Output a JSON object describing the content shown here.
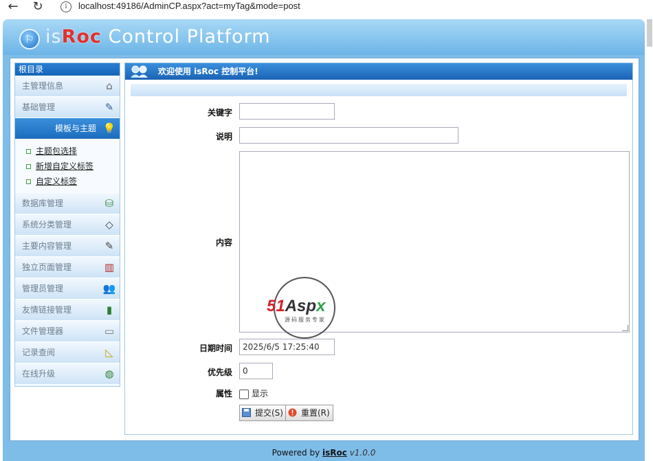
{
  "browser": {
    "back_icon": "←",
    "refresh_icon": "↻",
    "info_icon": "i",
    "url": "localhost:49186/AdminCP.aspx?act=myTag&mode=post"
  },
  "header": {
    "logo_mark": "⚐",
    "logo_is": "is",
    "logo_roc": "Roc",
    "logo_rest": " Control Platform"
  },
  "sidebar": {
    "root_label": "根目录",
    "items": [
      {
        "label": "主管理信息",
        "icon": "house-icon",
        "glyph": "⌂",
        "color": "#6b6b6b"
      },
      {
        "label": "基础管理",
        "icon": "tools-icon",
        "glyph": "✎",
        "color": "#3a5e9e"
      },
      {
        "label": "模板与主题",
        "icon": "lightbulb-icon",
        "glyph": "💡",
        "color": "#e8c23a",
        "active": true
      },
      {
        "label": "数据库管理",
        "icon": "database-icon",
        "glyph": "⛁",
        "color": "#3a8a3a"
      },
      {
        "label": "系统分类管理",
        "icon": "diamond-icon",
        "glyph": "◇",
        "color": "#444"
      },
      {
        "label": "主要内容管理",
        "icon": "book-icon",
        "glyph": "✎",
        "color": "#444"
      },
      {
        "label": "独立页面管理",
        "icon": "books-icon",
        "glyph": "▥",
        "color": "#b03030"
      },
      {
        "label": "管理员管理",
        "icon": "users-icon",
        "glyph": "👥",
        "color": "#555"
      },
      {
        "label": "友情链接管理",
        "icon": "battery-icon",
        "glyph": "▮",
        "color": "#2e7d32"
      },
      {
        "label": "文件管理器",
        "icon": "file-icon",
        "glyph": "▭",
        "color": "#777"
      },
      {
        "label": "记录查阅",
        "icon": "ruler-icon",
        "glyph": "◺",
        "color": "#c9a200"
      },
      {
        "label": "在线升级",
        "icon": "globe-icon",
        "glyph": "◍",
        "color": "#2e7d32"
      }
    ],
    "sub_items": [
      "主题包选择",
      "新增自定义标签",
      "自定义标签"
    ]
  },
  "main": {
    "title": "欢迎使用 isRoc 控制平台!",
    "form": {
      "keyword_label": "关键字",
      "keyword_value": "",
      "desc_label": "说明",
      "desc_value": "",
      "content_label": "内容",
      "datetime_label": "日期时间",
      "datetime_value": "2025/6/5 17:25:40",
      "priority_label": "优先级",
      "priority_value": "0",
      "attr_label": "属性",
      "show_label": "显示",
      "submit_label": "提交(S)",
      "reset_label": "重置(R)"
    }
  },
  "watermark": {
    "brand_51": "51",
    "brand_a": "A",
    "brand_sp": "sp",
    "brand_x": "x",
    "tagline": "源码服务专家"
  },
  "footer": {
    "prefix": "Powered by ",
    "brand": "isRoc",
    "version": " v1.0.0"
  },
  "colors": {
    "header_blue": "#7fbde9",
    "title_blue": "#1a63b4",
    "logo_red": "#e0322d"
  }
}
